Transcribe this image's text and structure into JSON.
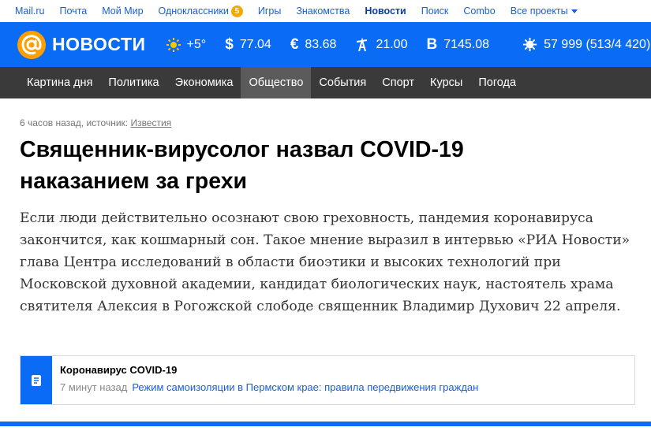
{
  "portal": {
    "links": [
      {
        "label": "Mail.ru"
      },
      {
        "label": "Почта"
      },
      {
        "label": "Мой Мир"
      },
      {
        "label": "Одноклассники",
        "badge": "5"
      },
      {
        "label": "Игры"
      },
      {
        "label": "Знакомства"
      },
      {
        "label": "Новости",
        "active": true
      },
      {
        "label": "Поиск"
      },
      {
        "label": "Combo"
      },
      {
        "label": "Все проекты",
        "dropdown": true
      }
    ]
  },
  "header": {
    "logo_text": "НОВОСТИ",
    "colors": {
      "brand_blue": "#0a6cf5",
      "logo_orange": "#ff9e00"
    },
    "widgets": [
      {
        "icon": "sun-icon",
        "value": "+5°"
      },
      {
        "icon": "dollar-icon",
        "symbol": "$",
        "value": "77.04"
      },
      {
        "icon": "euro-icon",
        "symbol": "€",
        "value": "83.68"
      },
      {
        "icon": "oil-derrick-icon",
        "value": "21.00"
      },
      {
        "icon": "bitcoin-icon",
        "symbol": "B",
        "value": "7145.08"
      },
      {
        "icon": "virus-icon",
        "value": "57 999 (513/4 420)"
      }
    ]
  },
  "nav": {
    "items": [
      {
        "label": "Картина дня"
      },
      {
        "label": "Политика"
      },
      {
        "label": "Экономика"
      },
      {
        "label": "Общество",
        "active": true
      },
      {
        "label": "События"
      },
      {
        "label": "Спорт"
      },
      {
        "label": "Курсы"
      },
      {
        "label": "Погода"
      }
    ]
  },
  "article": {
    "meta_prefix": "6 часов назад, источник: ",
    "source": "Известия",
    "title": "Священник-вирусолог назвал COVID-19 наказанием за грехи",
    "lead": "Если люди действительно осознают свою греховность, пандемия коронавируса закончится, как кошмарный сон. Такое мнение выразил в интервью «РИА Новости» глава Центра исследований в области биоэтики и высоких технологий при Московской духовной академии, кандидат биологических наук, настоятель храма святителя Алексия в Рогожской слободе священник Владимир Духович 22 апреля."
  },
  "related": {
    "title": "Коронавирус COVID-19",
    "time": "7 минут назад",
    "link": "Режим самоизоляции в Пермском крае: правила передвижения граждан"
  }
}
